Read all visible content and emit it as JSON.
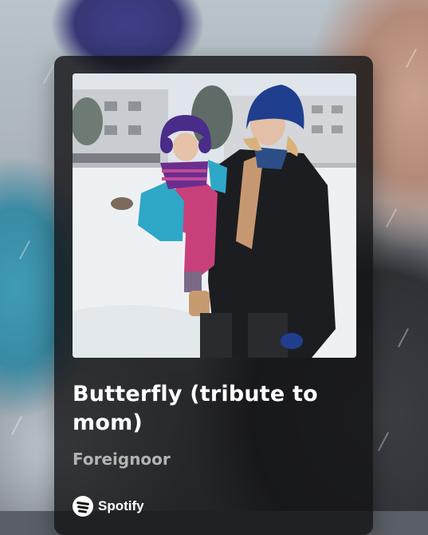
{
  "track": {
    "title": "Butterfly (tribute to mom)",
    "artist": "Foreignoor"
  },
  "brand": {
    "name": "Spotify",
    "logo_icon": "spotify-logo-icon"
  },
  "colors": {
    "card_background": "#141416",
    "title": "#ffffff",
    "artist": "#b3b3b3"
  }
}
